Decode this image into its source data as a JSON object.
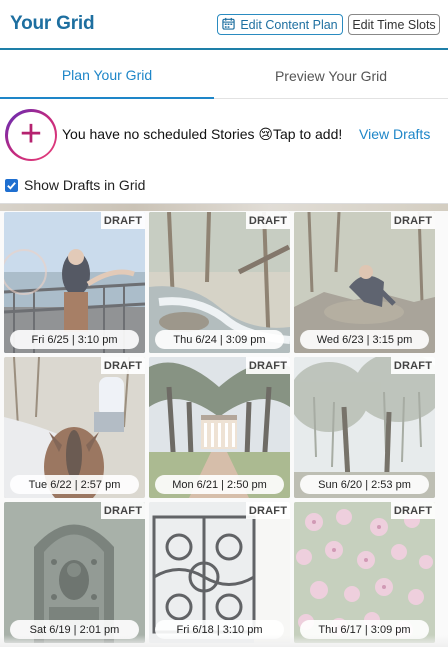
{
  "header": {
    "title": "Your Grid",
    "edit_content_plan_label": "Edit Content Plan",
    "edit_time_slots_label": "Edit Time Slots",
    "calendar_icon": "calendar-icon"
  },
  "tabs": [
    {
      "label": "Plan Your Grid",
      "active": true
    },
    {
      "label": "Preview Your Grid",
      "active": false
    }
  ],
  "stories": {
    "message": "You have no scheduled Stories 😢Tap to add!",
    "view_drafts_label": "View Drafts",
    "add_icon": "plus-icon"
  },
  "drafts_toggle": {
    "label": "Show Drafts in Grid",
    "checked": true
  },
  "grid": {
    "badge_label": "DRAFT",
    "posts": [
      {
        "date": "Fri 6/25 | 3:10 pm",
        "scene": "person-on-bridge"
      },
      {
        "date": "Thu 6/24 | 3:09 pm",
        "scene": "forest-creek"
      },
      {
        "date": "Wed 6/23 | 3:15 pm",
        "scene": "person-on-rocks"
      },
      {
        "date": "Tue 6/22 | 2:57 pm",
        "scene": "horse-riding-trail"
      },
      {
        "date": "Mon 6/21 | 2:50 pm",
        "scene": "oak-alley-plantation"
      },
      {
        "date": "Sun 6/20 | 2:53 pm",
        "scene": "mossy-oak-trees"
      },
      {
        "date": "Sat 6/19 | 2:01 pm",
        "scene": "ornate-plaque"
      },
      {
        "date": "Fri 6/18 | 3:10 pm",
        "scene": "iron-balcony"
      },
      {
        "date": "Thu 6/17 | 3:09 pm",
        "scene": "pink-flowers"
      }
    ]
  },
  "colors": {
    "accent": "#1e86c8",
    "title": "#1e6fa0",
    "checkbox": "#1f6fd0"
  }
}
